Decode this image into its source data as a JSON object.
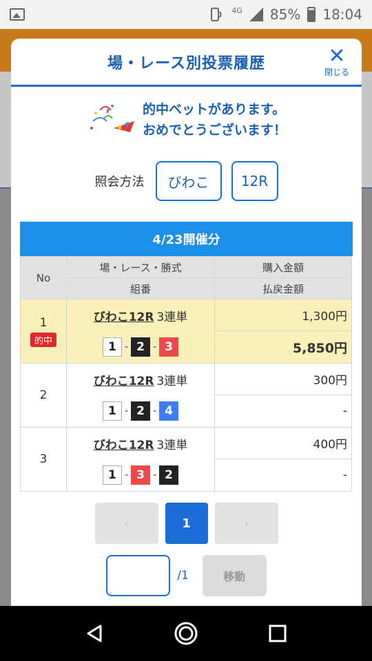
{
  "status_bar": {
    "battery": "85%",
    "time": "18:04",
    "network": "4G"
  },
  "modal": {
    "title": "場・レース別投票履歴",
    "close_label": "閉じる",
    "congrats_line1": "的中ベットがあります。",
    "congrats_line2": "おめでとうございます！",
    "query_label": "照会方法",
    "query_venue": "びわこ",
    "query_race": "12R",
    "date_header": "4/23開催分"
  },
  "table": {
    "headers": {
      "no": "No",
      "bet_type": "場・レース・勝式",
      "combination": "組番",
      "purchase": "購入金額",
      "payout": "払戻金額"
    },
    "rows": [
      {
        "no": "1",
        "badge": "的中",
        "venue_race": "びわこ12R",
        "type": "3連単",
        "c1": "1",
        "c2": "2",
        "c3": "3",
        "purchase": "1,300円",
        "payout": "5,850円"
      },
      {
        "no": "2",
        "venue_race": "びわこ12R",
        "type": "3連単",
        "c1": "1",
        "c2": "2",
        "c3": "4",
        "purchase": "300円",
        "payout": "-"
      },
      {
        "no": "3",
        "venue_race": "びわこ12R",
        "type": "3連単",
        "c1": "1",
        "c2": "3",
        "c3": "2",
        "purchase": "400円",
        "payout": "-"
      }
    ],
    "dash": "-"
  },
  "pager": {
    "prev": "‹",
    "current": "1",
    "next": "›"
  },
  "jump": {
    "total": "/1",
    "button": "移動"
  },
  "colors": {
    "accent": "#1a6cd6",
    "hit_bg": "#fbf0ba",
    "badge": "#e02a2a"
  }
}
